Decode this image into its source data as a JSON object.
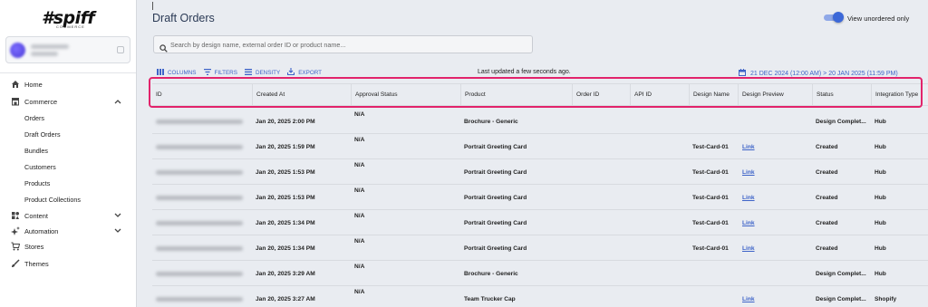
{
  "sidebar": {
    "logo": "#spiff",
    "logo_sub": "COMMERCE",
    "nav": [
      {
        "label": "Home",
        "icon": "home-icon"
      },
      {
        "label": "Commerce",
        "icon": "store-icon"
      },
      {
        "label": "Content",
        "icon": "content-icon"
      },
      {
        "label": "Automation",
        "icon": "sparkle-icon"
      },
      {
        "label": "Stores",
        "icon": "cart-icon"
      },
      {
        "label": "Themes",
        "icon": "brush-icon"
      }
    ],
    "commerce_items": [
      "Orders",
      "Draft Orders",
      "Bundles",
      "Customers",
      "Products",
      "Product Collections"
    ]
  },
  "header": {
    "title": "Draft Orders",
    "toggle_label": "View unordered only",
    "toggle_on": true
  },
  "search": {
    "placeholder": "Search by design name, external order ID or product name..."
  },
  "toolbar": {
    "columns": "COLUMNS",
    "filters": "FILTERS",
    "density": "DENSITY",
    "export": "EXPORT",
    "updated": "Last updated a few seconds ago.",
    "date_range": "21 DEC 2024 (12:00 AM) > 20 JAN 2025 (11:59 PM)"
  },
  "table": {
    "columns": [
      "ID",
      "Created At",
      "Approval Status",
      "Product",
      "Order ID",
      "API ID",
      "Design Name",
      "Design Preview",
      "Status",
      "Integration Type"
    ],
    "rows": [
      {
        "created": "Jan 20, 2025 2:00 PM",
        "approval": "N/A",
        "product": "Brochure - Generic",
        "design_name": "",
        "preview": "",
        "status": "Design Complet...",
        "integration": "Hub"
      },
      {
        "created": "Jan 20, 2025 1:59 PM",
        "approval": "N/A",
        "product": "Portrait Greeting Card",
        "design_name": "Test-Card-01",
        "preview": "Link",
        "status": "Created",
        "integration": "Hub"
      },
      {
        "created": "Jan 20, 2025 1:53 PM",
        "approval": "N/A",
        "product": "Portrait Greeting Card",
        "design_name": "Test-Card-01",
        "preview": "Link",
        "status": "Created",
        "integration": "Hub"
      },
      {
        "created": "Jan 20, 2025 1:53 PM",
        "approval": "N/A",
        "product": "Portrait Greeting Card",
        "design_name": "Test-Card-01",
        "preview": "Link",
        "status": "Created",
        "integration": "Hub"
      },
      {
        "created": "Jan 20, 2025 1:34 PM",
        "approval": "N/A",
        "product": "Portrait Greeting Card",
        "design_name": "Test-Card-01",
        "preview": "Link",
        "status": "Created",
        "integration": "Hub"
      },
      {
        "created": "Jan 20, 2025 1:34 PM",
        "approval": "N/A",
        "product": "Portrait Greeting Card",
        "design_name": "Test-Card-01",
        "preview": "Link",
        "status": "Created",
        "integration": "Hub"
      },
      {
        "created": "Jan 20, 2025 3:29 AM",
        "approval": "N/A",
        "product": "Brochure - Generic",
        "design_name": "",
        "preview": "",
        "status": "Design Complet...",
        "integration": "Hub"
      },
      {
        "created": "Jan 20, 2025 3:27 AM",
        "approval": "N/A",
        "product": "Team Trucker Cap",
        "design_name": "",
        "preview": "Link",
        "status": "Design Complet...",
        "integration": "Shopify"
      }
    ]
  },
  "colors": {
    "accent": "#3d63c8",
    "highlight": "#e2236b",
    "sidebar_bg": "#ffffff",
    "main_bg": "#e9ecf1"
  }
}
